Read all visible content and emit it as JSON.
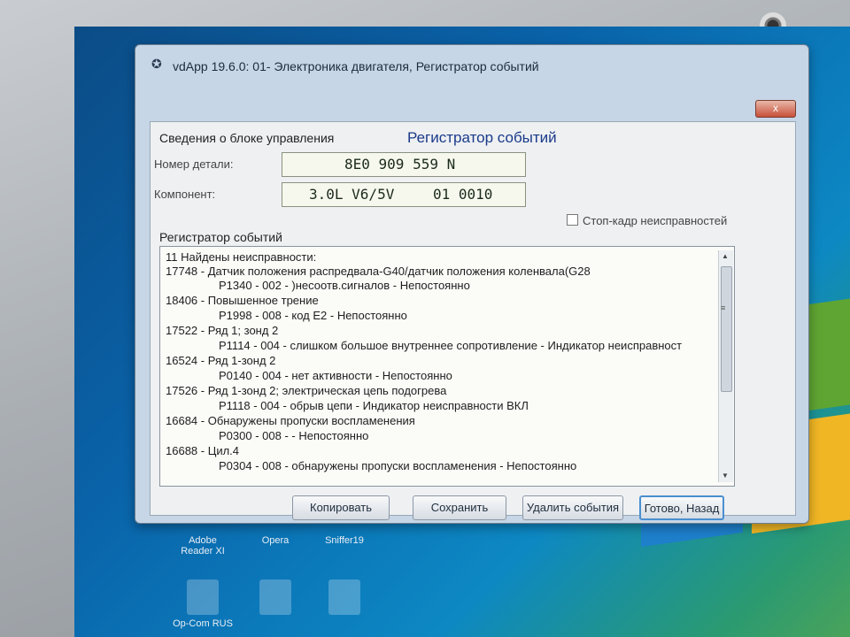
{
  "window": {
    "title": "vdApp 19.6.0: 01- Электроника двигателя,  Регистратор событий",
    "close_label": "x",
    "heading": "Регистратор событий"
  },
  "control_unit": {
    "group_label": "Сведения о блоке управления",
    "part_label": "Номер детали:",
    "part_value": "8E0 909 559 N",
    "component_label": "Компонент:",
    "component_value": "3.0L V6/5V",
    "component_code": "01 0010",
    "freeze_frame_label": "Стоп-кадр неисправностей"
  },
  "event_log": {
    "label": "Регистратор событий",
    "lines": [
      "11 Найдены неисправности:",
      "17748 - Датчик положения распредвала-G40/датчик положения коленвала(G28",
      "P1340 - 002 - )несоотв.сигналов - Непостоянно",
      "18406 - Повышенное трение",
      "P1998 - 008 - код E2 - Непостоянно",
      "17522 - Ряд 1; зонд 2",
      "P1114 - 004 - слишком большое внутреннее сопротивление - Индикатор неисправност",
      "16524 - Ряд 1-зонд 2",
      "P0140 - 004 - нет активности - Непостоянно",
      "17526 - Ряд 1-зонд 2; электрическая цепь подогрева",
      "P1118 - 004 - обрыв цепи - Индикатор неисправности ВКЛ",
      "16684 - Обнаружены пропуски воспламенения",
      "P0300 - 008 -  - Непостоянно",
      "16688 - Цил.4",
      "P0304 - 008 - обнаружены пропуски воспламенения - Непостоянно"
    ]
  },
  "buttons": {
    "copy": "Копировать",
    "save": "Сохранить",
    "delete": "Удалить события",
    "done": "Готово, Назад"
  },
  "desktop": {
    "icons": [
      "Adobe Reader XI",
      "Opera",
      "Sniffer19",
      "Op-Com RUS"
    ]
  }
}
